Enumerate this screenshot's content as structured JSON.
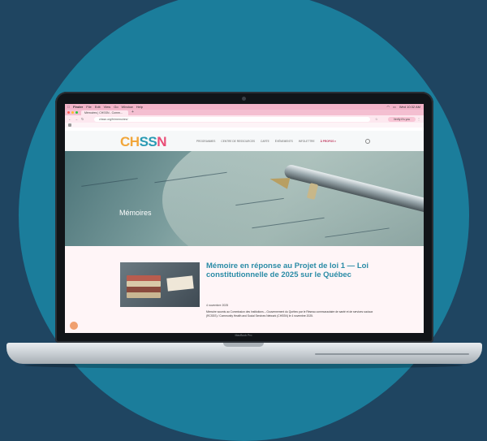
{
  "colors": {
    "background": "#1f4561",
    "circle": "#1b7d9b",
    "accent_title": "#2a8ba6",
    "logo_orange": "#f1a63b",
    "logo_teal": "#2a9bb4",
    "logo_pink": "#e94e77"
  },
  "os": {
    "menubar": [
      "Finder",
      "File",
      "Edit",
      "View",
      "Go",
      "Window",
      "Help"
    ],
    "clock": "Wed 10:32 AM"
  },
  "browser": {
    "tab_title": "Mémoires | CHSSN - Comm...",
    "url": "chssn.org/fr/memoires/",
    "profile_label": "Verify it's you",
    "icons": [
      "back-icon",
      "forward-icon",
      "reload-icon",
      "star-icon",
      "menu-icon"
    ]
  },
  "site": {
    "logo": {
      "part1": "CH",
      "part2": "SS",
      "part3": "N"
    },
    "nav": [
      "PROGRAMMES",
      "CENTRE DE RESSOURCES",
      "CARTE",
      "ÉVÉNEMENTS",
      "INFOLETTRE",
      "À PROPOS ▾"
    ],
    "hero_title": "Mémoires",
    "article": {
      "title": "Mémoire en réponse au Projet de loi 1 — Loi constitutionnelle de 2025 sur le Québec",
      "date": "4 novembre 2025",
      "excerpt": "Mémoire soumis au Commission des Institutions – Gouvernement du Québec par le Réseau communautaire de santé et de services sociaux (RCSSS) / Community Health and Social Services Network (CHSSN) le 4 novembre 2025."
    }
  },
  "laptop": {
    "model_label": "MacBook Pro"
  }
}
